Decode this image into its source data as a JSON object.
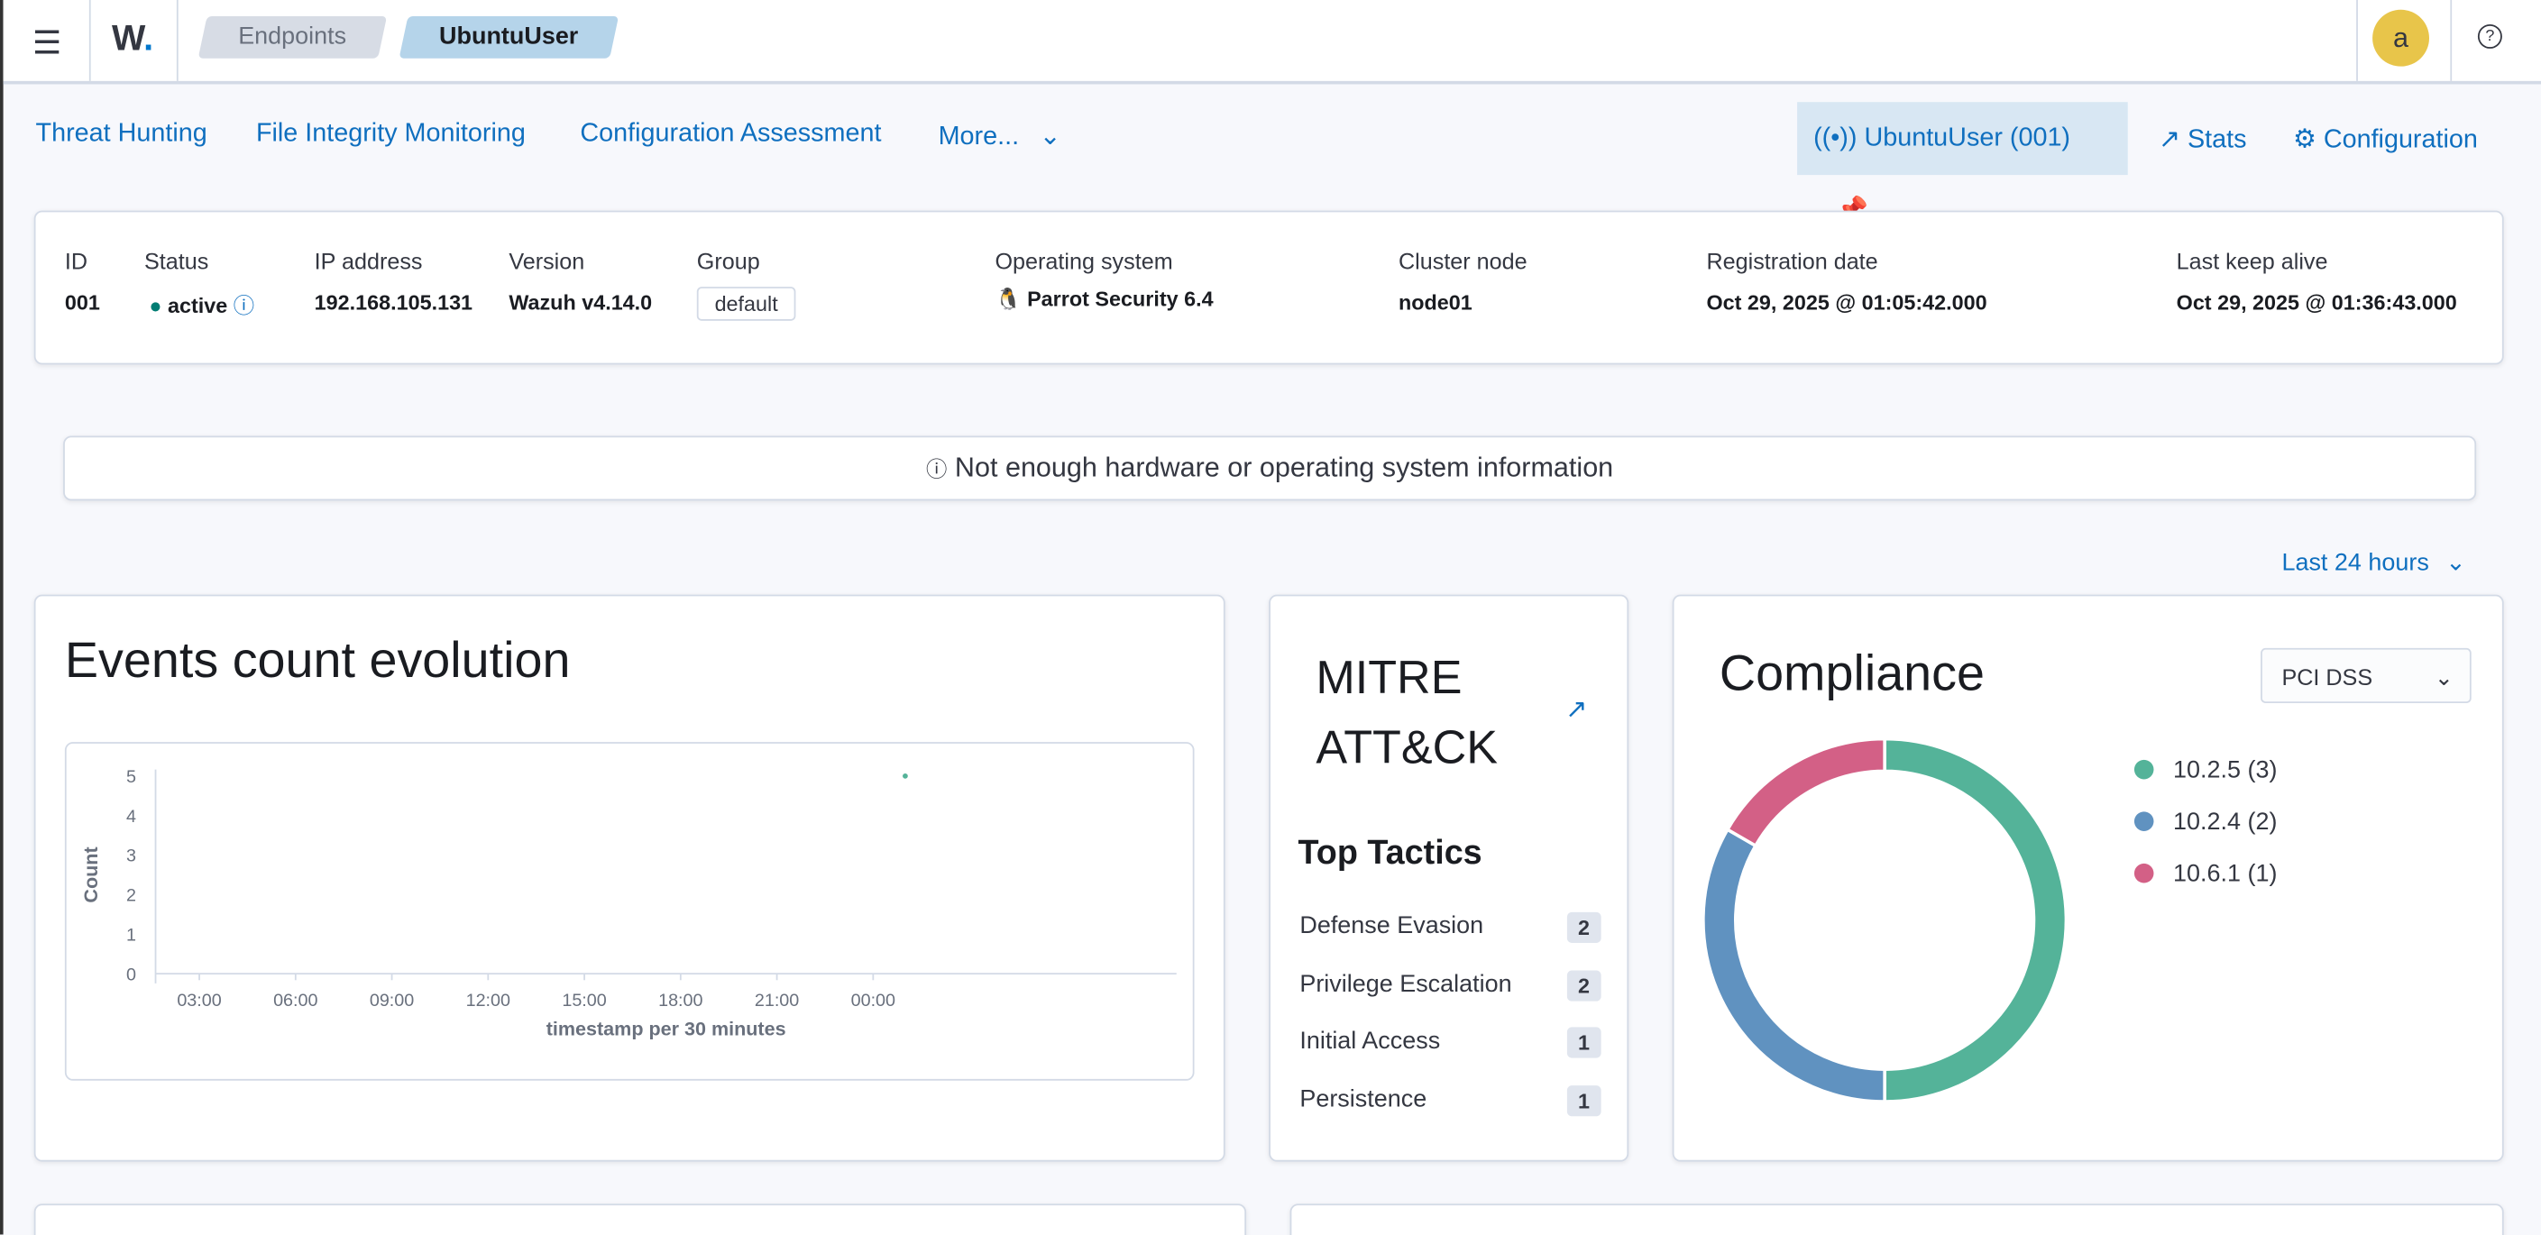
{
  "header": {
    "breadcrumbs": [
      "Endpoints",
      "UbuntuUser"
    ],
    "avatar": "a"
  },
  "nav": {
    "tabs": [
      "Threat Hunting",
      "File Integrity Monitoring",
      "Configuration Assessment",
      "More..."
    ],
    "agent_button": "UbuntuUser (001)",
    "stats": "Stats",
    "configuration": "Configuration"
  },
  "agent": {
    "labels": {
      "id": "ID",
      "status": "Status",
      "ip": "IP address",
      "version": "Version",
      "group": "Group",
      "os": "Operating system",
      "cluster": "Cluster node",
      "reg": "Registration date",
      "keepalive": "Last keep alive"
    },
    "id": "001",
    "status": "active",
    "ip": "192.168.105.131",
    "version": "Wazuh v4.14.0",
    "group": "default",
    "os": "Parrot Security 6.4",
    "cluster": "node01",
    "reg": "Oct 29, 2025 @ 01:05:42.000",
    "keepalive": "Oct 29, 2025 @ 01:36:43.000"
  },
  "notice": "Not enough hardware or operating system information",
  "time_range": "Last 24 hours",
  "events": {
    "title": "Events count evolution"
  },
  "chart_data": {
    "type": "line",
    "title": "Events count evolution",
    "xlabel": "timestamp per 30 minutes",
    "ylabel": "Count",
    "ylim": [
      0,
      5
    ],
    "yticks": [
      "0",
      "1",
      "2",
      "3",
      "4",
      "5"
    ],
    "xticks": [
      "03:00",
      "06:00",
      "09:00",
      "12:00",
      "15:00",
      "18:00",
      "21:00",
      "00:00"
    ],
    "points": [
      {
        "x": "01:00",
        "y": 5
      }
    ]
  },
  "mitre": {
    "title1": "MITRE",
    "title2": "ATT&CK",
    "subtitle": "Top Tactics",
    "tactics": [
      {
        "name": "Defense Evasion",
        "count": "2"
      },
      {
        "name": "Privilege Escalation",
        "count": "2"
      },
      {
        "name": "Initial Access",
        "count": "1"
      },
      {
        "name": "Persistence",
        "count": "1"
      }
    ]
  },
  "compliance": {
    "title": "Compliance",
    "select": "PCI DSS",
    "items": [
      {
        "label": "10.2.5 (3)",
        "value": 3,
        "color": "#54b399"
      },
      {
        "label": "10.2.4 (2)",
        "value": 2,
        "color": "#6092c0"
      },
      {
        "label": "10.6.1 (1)",
        "value": 1,
        "color": "#d36086"
      }
    ]
  }
}
